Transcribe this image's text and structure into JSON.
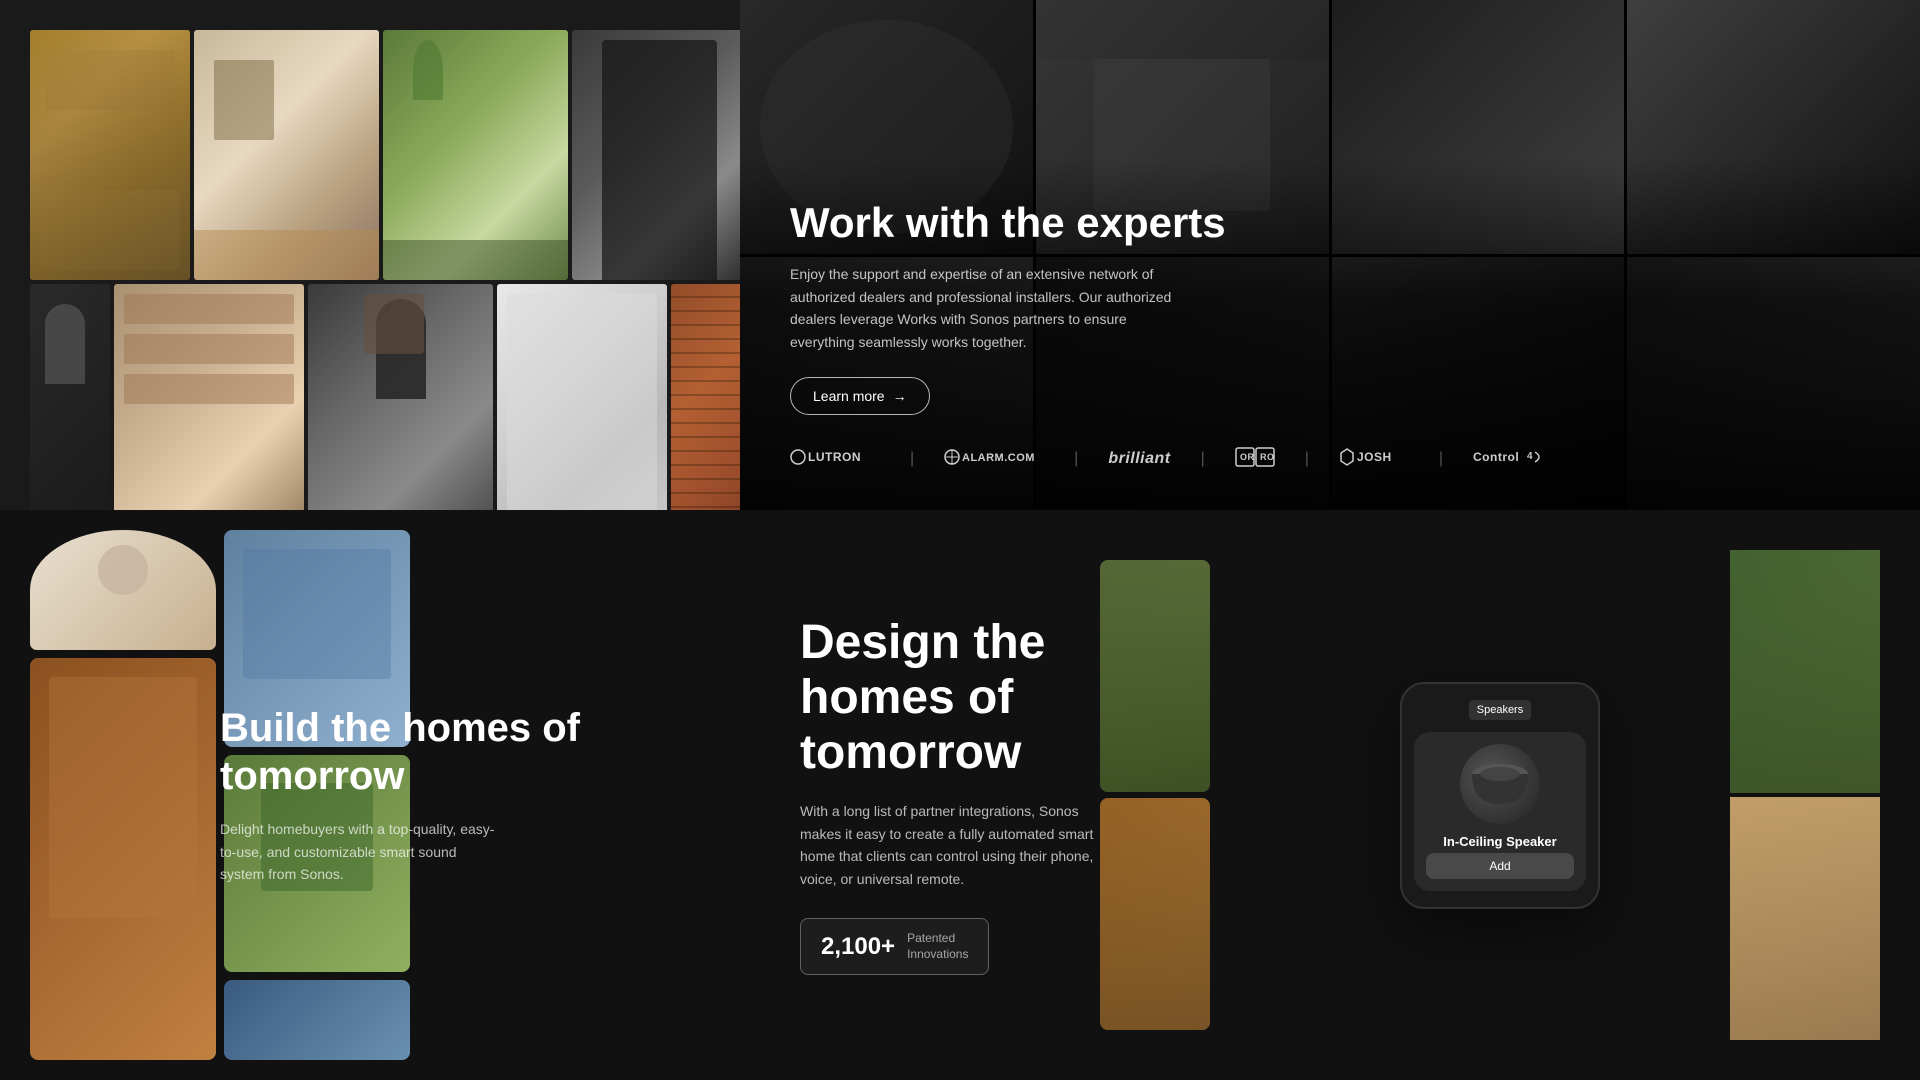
{
  "topLeft": {
    "photos": [
      {
        "id": "living-room",
        "style": "photo-living"
      },
      {
        "id": "kitchen",
        "style": "photo-kitchen"
      },
      {
        "id": "plants-kitchen",
        "style": "photo-plants"
      },
      {
        "id": "door",
        "style": "photo-door"
      },
      {
        "id": "man-back",
        "style": "photo-man-back"
      },
      {
        "id": "shelf",
        "style": "photo-shelf"
      },
      {
        "id": "installer",
        "style": "photo-installer"
      },
      {
        "id": "bathroom",
        "style": "photo-bathroom"
      },
      {
        "id": "brick",
        "style": "photo-brick"
      }
    ]
  },
  "experts": {
    "title": "Work with the experts",
    "description": "Enjoy the support and expertise of an extensive network of authorized dealers and professional installers. Our authorized dealers leverage Works with Sonos partners to ensure everything seamlessly works together.",
    "cta_label": "Learn more",
    "partners": [
      {
        "name": "OLUTRON",
        "display": "●LUTRON"
      },
      {
        "name": "alarm-com",
        "display": "⊕ ALARM.COM"
      },
      {
        "name": "brilliant",
        "display": "brilliant"
      },
      {
        "name": "or-or",
        "display": "OR OR"
      },
      {
        "name": "josh",
        "display": "⬡ JOSH"
      },
      {
        "name": "control4",
        "display": "Control4"
      }
    ]
  },
  "build": {
    "title": "Build the homes of tomorrow",
    "description": "Delight homebuyers with a top-quality, easy-to-use, and customizable smart sound system from Sonos."
  },
  "design": {
    "title": "Design the homes of tomorrow",
    "description": "With a long list of partner integrations, Sonos makes it easy to create a fully automated smart home that clients can control using their phone, voice, or universal remote.",
    "badge_number": "2,100+",
    "badge_label_line1": "Patented",
    "badge_label_line2": "Innovations",
    "phone": {
      "tab_label": "Speakers",
      "speaker_name": "In-Ceiling Speaker",
      "add_button": "Add"
    }
  }
}
